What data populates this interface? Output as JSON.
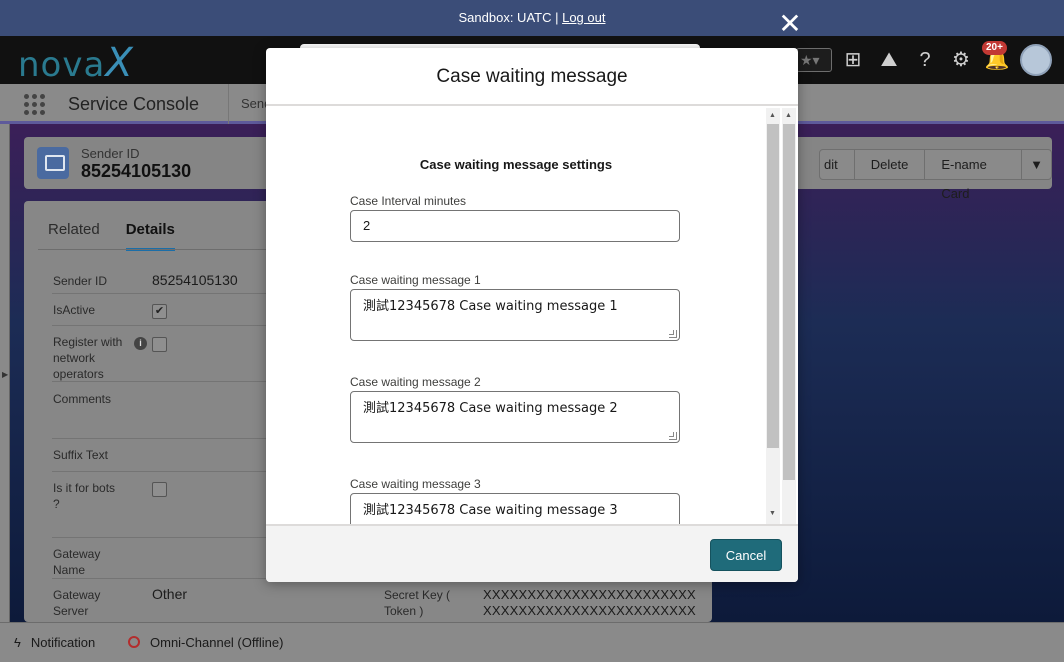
{
  "sandbox": {
    "prefix": "Sandbox: UATC | ",
    "logout": "Log out"
  },
  "header": {
    "logo_text": "nova",
    "logo_x": "X",
    "notification_count": "20+"
  },
  "nav": {
    "app_name": "Service Console",
    "tab_partial": "Send"
  },
  "record": {
    "type_label": "Sender ID",
    "name": "85254105130",
    "actions": {
      "edit": "dit",
      "delete": "Delete",
      "ename": "E-name Card"
    }
  },
  "details": {
    "tabs": {
      "related": "Related",
      "details": "Details"
    },
    "fields": {
      "sender_id_label": "Sender ID",
      "sender_id_value": "85254105130",
      "isactive_label": "IsActive",
      "register_label": "Register with network operators",
      "comments_label": "Comments",
      "suffix_label": "Suffix Text",
      "bots_label": "Is it for bots ?",
      "gateway_name_label": "Gateway Name",
      "gateway_server_label": "Gateway Server",
      "gateway_server_value": "Other",
      "secret_key_label": "Secret Key ( Token )",
      "secret_key_line1": "XXXXXXXXXXXXXXXXXXXXXXXX",
      "secret_key_line2": "XXXXXXXXXXXXXXXXXXXXXXXX"
    }
  },
  "utility": {
    "notification": "Notification",
    "omni": "Omni-Channel (Offline)"
  },
  "modal": {
    "title": "Case waiting message",
    "section_title": "Case waiting message settings",
    "interval_label": "Case Interval minutes",
    "interval_value": "2",
    "msg1_label": "Case waiting message 1",
    "msg1_value": "測試12345678 Case waiting message 1",
    "msg2_label": "Case waiting message 2",
    "msg2_value": "測試12345678 Case waiting message 2",
    "msg3_label": "Case waiting message 3",
    "msg3_value": "測試12345678 Case waiting message 3",
    "cancel": "Cancel"
  },
  "icons": {
    "close": "close-icon",
    "app_launcher": "waffle-icon",
    "favorites": "star-icon",
    "add": "plus-icon",
    "trailhead": "trailhead-icon",
    "help": "help-icon",
    "setup": "gear-icon",
    "notifications": "bell-icon",
    "utility_notification": "lightning-icon"
  }
}
